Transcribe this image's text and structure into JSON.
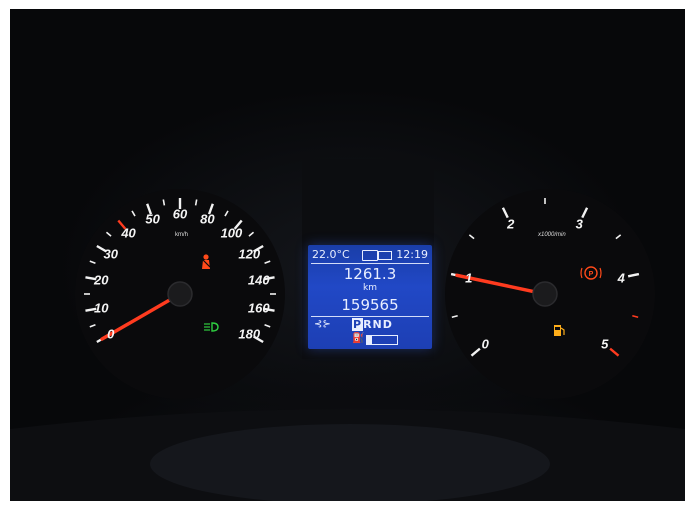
{
  "speedometer": {
    "unit": "km/h",
    "labels": [
      "0",
      "10",
      "20",
      "30",
      "40",
      "50",
      "60",
      "80",
      "100",
      "120",
      "140",
      "160",
      "180"
    ],
    "speed_kmh": 0
  },
  "tachometer": {
    "unit": "x1000/min",
    "labels": [
      "0",
      "1",
      "2",
      "3",
      "4",
      "5"
    ],
    "rpm_x1000": 1
  },
  "display": {
    "temperature": "22.0°C",
    "clock": "12:19",
    "trip_value": "1261.3",
    "trip_unit": "km",
    "odometer": "159565",
    "gear_active": "P",
    "gear_rest": "RND",
    "fuel_level": 0.15
  },
  "icons": [
    "seatbelt-warning-icon",
    "headlight-icon",
    "parking-brake-icon",
    "fuel-warning-icon",
    "lane-assist-icon"
  ],
  "colors": {
    "needle": "#ff3b1f",
    "amber": "#ffae1a",
    "green": "#2ecc40",
    "lcd": "#1d3fb4"
  }
}
